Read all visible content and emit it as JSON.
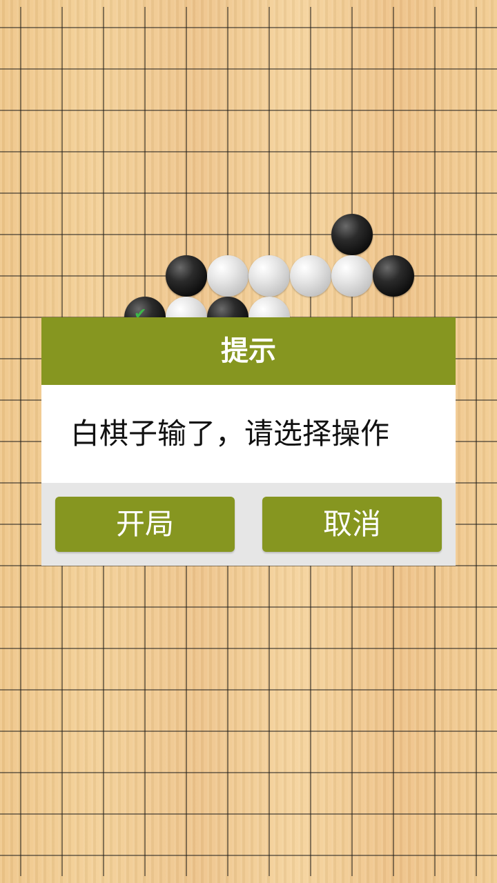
{
  "board": {
    "colors": {
      "line": "#1a1a1a",
      "black_stone": "#111111",
      "white_stone": "#d0d0d0",
      "last_move_mark": "#3db84a"
    },
    "stones": [
      {
        "color": "black",
        "col": 8,
        "row": 5
      },
      {
        "color": "black",
        "col": 4,
        "row": 6
      },
      {
        "color": "white",
        "col": 5,
        "row": 6
      },
      {
        "color": "white",
        "col": 6,
        "row": 6
      },
      {
        "color": "white",
        "col": 7,
        "row": 6
      },
      {
        "color": "white",
        "col": 8,
        "row": 6
      },
      {
        "color": "black",
        "col": 9,
        "row": 6
      },
      {
        "color": "black",
        "col": 3,
        "row": 7,
        "last_move": true
      },
      {
        "color": "white",
        "col": 4,
        "row": 7
      },
      {
        "color": "black",
        "col": 5,
        "row": 7
      },
      {
        "color": "white",
        "col": 6,
        "row": 7
      }
    ]
  },
  "dialog": {
    "title": "提示",
    "message": "白棋子输了，请选择操作",
    "buttons": {
      "new_game_label": "开局",
      "cancel_label": "取消"
    },
    "colors": {
      "accent": "#869620",
      "body": "#ffffff",
      "footer": "#e6e6e6"
    }
  }
}
